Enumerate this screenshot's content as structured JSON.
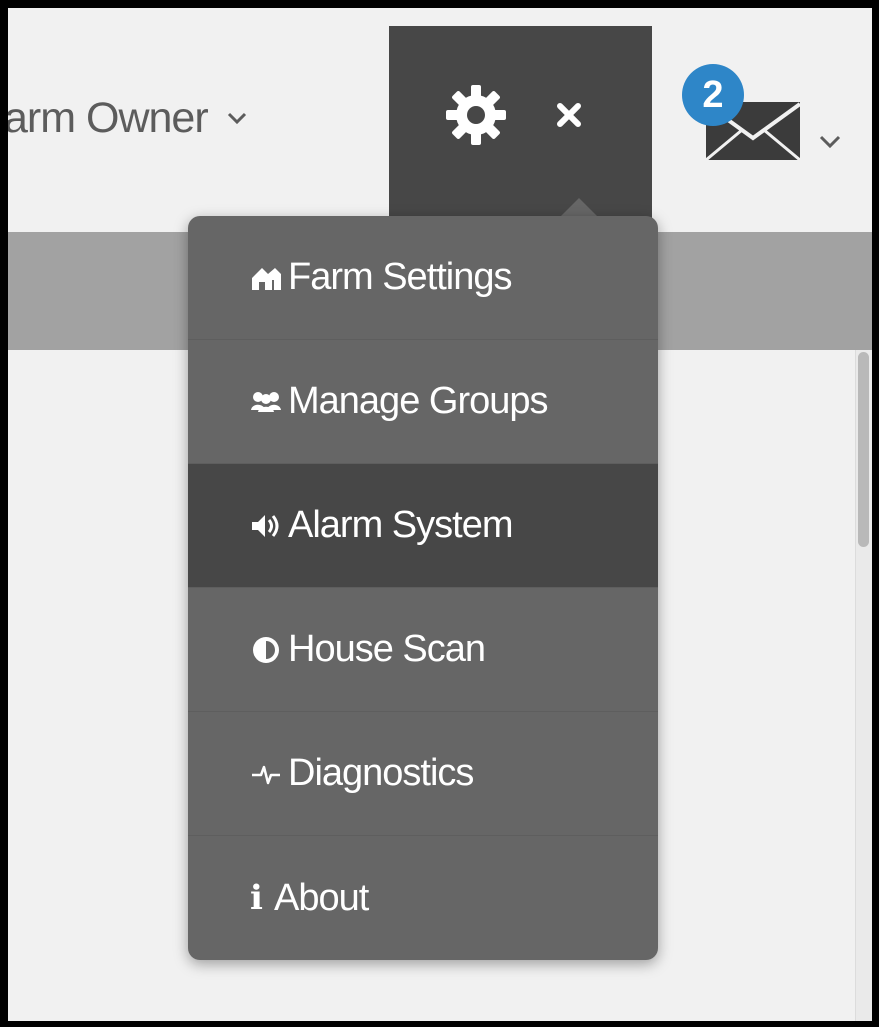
{
  "header": {
    "user_label": "arm Owner",
    "settings_icon": "gear-icon",
    "close_icon": "close-icon",
    "mail_icon": "envelope-icon",
    "mail_badge_count": "2",
    "badge_color": "#2e86c8"
  },
  "settings_menu": {
    "items": [
      {
        "label": "Farm Settings",
        "icon": "farm-icon",
        "active": false
      },
      {
        "label": "Manage Groups",
        "icon": "groups-icon",
        "active": false
      },
      {
        "label": "Alarm System",
        "icon": "alarm-icon",
        "active": true
      },
      {
        "label": "House Scan",
        "icon": "house-scan-icon",
        "active": false
      },
      {
        "label": "Diagnostics",
        "icon": "diagnostics-icon",
        "active": false
      },
      {
        "label": "About",
        "icon": "info-icon",
        "active": false
      }
    ]
  },
  "colors": {
    "menu_bg": "#666666",
    "menu_active_bg": "#474747",
    "header_button_bg": "#474747"
  }
}
